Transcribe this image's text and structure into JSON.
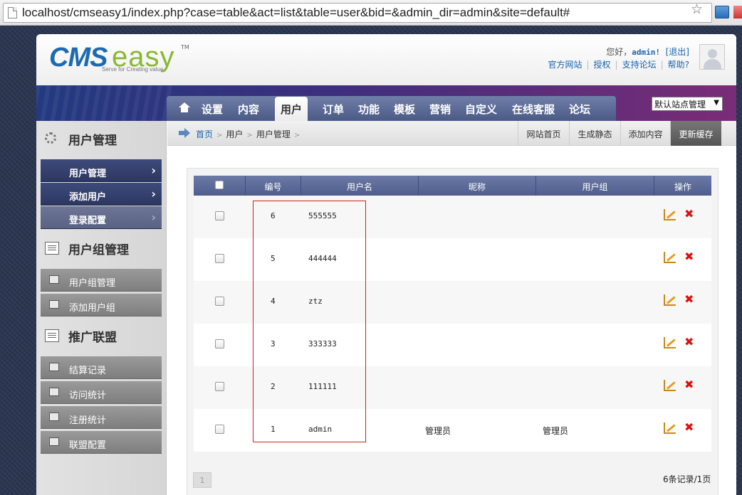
{
  "browser": {
    "url": "localhost/cmseasy1/index.php?case=table&act=list&table=user&bid=&admin_dir=admin&site=default#"
  },
  "logo": {
    "main": "CMS",
    "accent": "easy",
    "tm": "TM",
    "tagline": "Serve for Creating value"
  },
  "header": {
    "greeting": "您好，",
    "username": "admin!",
    "logout": "[退出]",
    "links": [
      "官方网站",
      "授权",
      "支持论坛",
      "帮助?"
    ]
  },
  "nav": {
    "tabs": [
      "设置",
      "内容",
      "用户",
      "订单",
      "功能",
      "模板",
      "营销",
      "自定义",
      "在线客服",
      "论坛"
    ],
    "active": "用户",
    "site_select": "默认站点管理"
  },
  "sidebar": {
    "sections": [
      {
        "title": "用户管理",
        "icon": "gear-icon",
        "items": [
          "用户管理",
          "添加用户",
          "登录配置"
        ]
      },
      {
        "title": "用户组管理",
        "icon": "list-icon",
        "items": [
          "用户组管理",
          "添加用户组"
        ]
      },
      {
        "title": "推广联盟",
        "icon": "list-icon",
        "items": [
          "结算记录",
          "访问统计",
          "注册统计",
          "联盟配置"
        ]
      }
    ]
  },
  "breadcrumb": {
    "items": [
      "首页",
      "用户",
      "用户管理"
    ],
    "actions": [
      "网站首页",
      "生成静态",
      "添加内容",
      "更新缓存"
    ]
  },
  "table": {
    "headers": [
      "编号",
      "用户名",
      "昵称",
      "用户组",
      "操作"
    ],
    "rows": [
      {
        "id": "6",
        "username": "555555",
        "nickname": "",
        "group": ""
      },
      {
        "id": "5",
        "username": "444444",
        "nickname": "",
        "group": ""
      },
      {
        "id": "4",
        "username": "ztz",
        "nickname": "",
        "group": ""
      },
      {
        "id": "3",
        "username": "333333",
        "nickname": "",
        "group": ""
      },
      {
        "id": "2",
        "username": "111111",
        "nickname": "",
        "group": ""
      },
      {
        "id": "1",
        "username": "admin",
        "nickname": "管理员",
        "group": "管理员"
      }
    ]
  },
  "pager": {
    "current": "1",
    "info": "6条记录/1页"
  },
  "colors": {
    "nav_start": "#233a80",
    "nav_end": "#7a2c77",
    "link": "#1c63ad",
    "delete": "#dd1111",
    "highlight": "#d02020"
  }
}
